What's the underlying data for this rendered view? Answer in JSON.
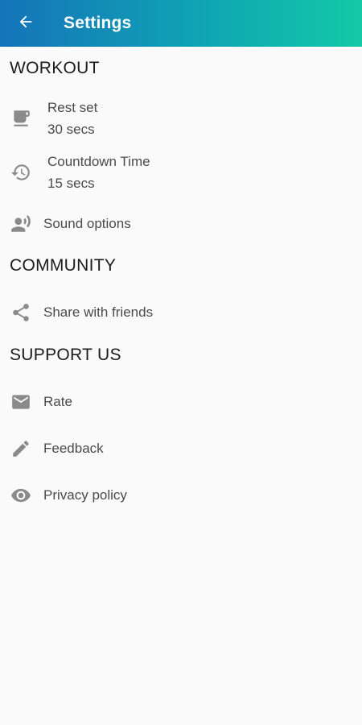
{
  "app_bar": {
    "title": "Settings",
    "back_icon": "arrow-back-icon"
  },
  "sections": {
    "workout": {
      "header": "WORKOUT",
      "rest_set": {
        "label": "Rest set",
        "value": "30 secs",
        "icon": "coffee-cup-icon"
      },
      "countdown": {
        "label": "Countdown Time",
        "value": "15 secs",
        "icon": "history-icon"
      },
      "sound": {
        "label": "Sound options",
        "icon": "record-voice-icon"
      }
    },
    "community": {
      "header": "COMMUNITY",
      "share": {
        "label": "Share with friends",
        "icon": "share-icon"
      }
    },
    "support": {
      "header": "SUPPORT US",
      "rate": {
        "label": "Rate",
        "icon": "mail-icon"
      },
      "feedback": {
        "label": "Feedback",
        "icon": "pencil-icon"
      },
      "privacy": {
        "label": "Privacy policy",
        "icon": "eye-icon"
      }
    }
  },
  "colors": {
    "app_bar_start": "#1573b9",
    "app_bar_end": "#13c9a6",
    "icon": "#8a8a8a",
    "background": "#fafafa"
  }
}
